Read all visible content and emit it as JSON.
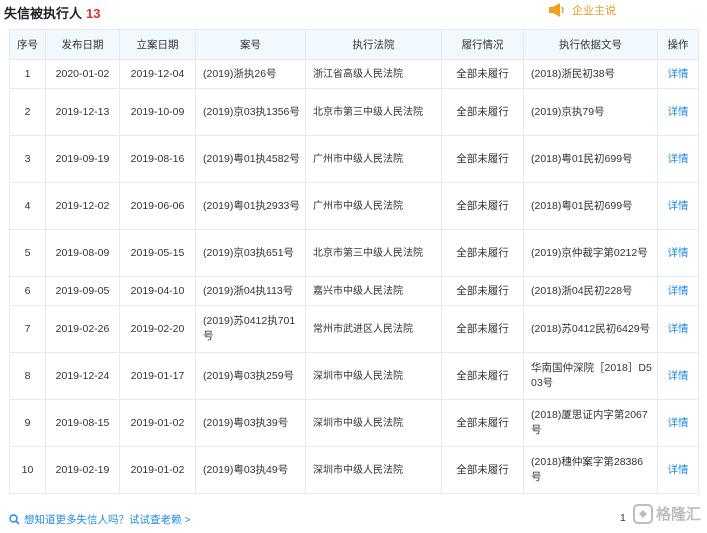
{
  "header": {
    "title": "失信被执行人",
    "count": "13",
    "hint_text": "企业主说",
    "hint_icon": "speaker-icon"
  },
  "table": {
    "columns": [
      "序号",
      "发布日期",
      "立案日期",
      "案号",
      "执行法院",
      "履行情况",
      "执行依据文号",
      "操作"
    ],
    "rows": [
      {
        "no": "1",
        "publish": "2020-01-02",
        "filed": "2019-12-04",
        "case": "(2019)浙执26号",
        "court": "浙江省高级人民法院",
        "status": "全部未履行",
        "basis": "(2018)浙民初38号",
        "action": "详情"
      },
      {
        "no": "2",
        "publish": "2019-12-13",
        "filed": "2019-10-09",
        "case": "(2019)京03执1356号",
        "court": "北京市第三中级人民法院",
        "status": "全部未履行",
        "basis": "(2019)京执79号",
        "action": "详情"
      },
      {
        "no": "3",
        "publish": "2019-09-19",
        "filed": "2019-08-16",
        "case": "(2019)粤01执4582号",
        "court": "广州市中级人民法院",
        "status": "全部未履行",
        "basis": "(2018)粤01民初699号",
        "action": "详情"
      },
      {
        "no": "4",
        "publish": "2019-12-02",
        "filed": "2019-06-06",
        "case": "(2019)粤01执2933号",
        "court": "广州市中级人民法院",
        "status": "全部未履行",
        "basis": "(2018)粤01民初699号",
        "action": "详情"
      },
      {
        "no": "5",
        "publish": "2019-08-09",
        "filed": "2019-05-15",
        "case": "(2019)京03执651号",
        "court": "北京市第三中级人民法院",
        "status": "全部未履行",
        "basis": "(2019)京仲裁字第0212号",
        "action": "详情"
      },
      {
        "no": "6",
        "publish": "2019-09-05",
        "filed": "2019-04-10",
        "case": "(2019)浙04执113号",
        "court": "嘉兴市中级人民法院",
        "status": "全部未履行",
        "basis": "(2018)浙04民初228号",
        "action": "详情"
      },
      {
        "no": "7",
        "publish": "2019-02-26",
        "filed": "2019-02-20",
        "case": "(2019)苏0412执701号",
        "court": "常州市武进区人民法院",
        "status": "全部未履行",
        "basis": "(2018)苏0412民初6429号",
        "action": "详情"
      },
      {
        "no": "8",
        "publish": "2019-12-24",
        "filed": "2019-01-17",
        "case": "(2019)粤03执259号",
        "court": "深圳市中级人民法院",
        "status": "全部未履行",
        "basis": "华南国仲深院［2018］D503号",
        "action": "详情"
      },
      {
        "no": "9",
        "publish": "2019-08-15",
        "filed": "2019-01-02",
        "case": "(2019)粤03执39号",
        "court": "深圳市中级人民法院",
        "status": "全部未履行",
        "basis": "(2018)厦思证内字第2067号",
        "action": "详情"
      },
      {
        "no": "10",
        "publish": "2019-02-19",
        "filed": "2019-01-02",
        "case": "(2019)粤03执49号",
        "court": "深圳市中级人民法院",
        "status": "全部未履行",
        "basis": "(2018)穗仲案字第28386号",
        "action": "详情"
      }
    ]
  },
  "footer": {
    "link_text": "想知道更多失信人吗？试试查老赖 >",
    "link_icon": "search-icon",
    "page_number": "1",
    "watermark_text": "格隆汇"
  },
  "colors": {
    "accent_red": "#e0332f",
    "link_blue": "#1e8be0",
    "hint_orange": "#e59a2b",
    "header_bg": "#f2f9fe",
    "border": "#e3eaf2"
  }
}
